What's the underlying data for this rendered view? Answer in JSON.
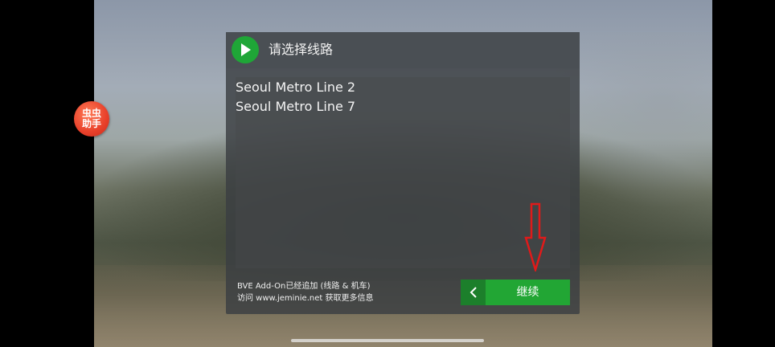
{
  "helper_badge": {
    "label": "虫虫助手"
  },
  "dialog": {
    "title": "请选择线路",
    "routes": [
      {
        "label": "Seoul Metro Line 2"
      },
      {
        "label": "Seoul Metro Line 7"
      }
    ],
    "footer_line1": "BVE Add-On已经追加 (线路 & 机车)",
    "footer_line2": "访问 www.jeminie.net 获取更多信息",
    "continue_label": "继续"
  },
  "colors": {
    "accent_green": "#22a634",
    "back_green": "#1c7f2b",
    "annotation_red": "#e01a1a"
  },
  "icons": {
    "header": "play-icon",
    "back": "chevron-left-icon",
    "annotation": "down-arrow-icon"
  }
}
